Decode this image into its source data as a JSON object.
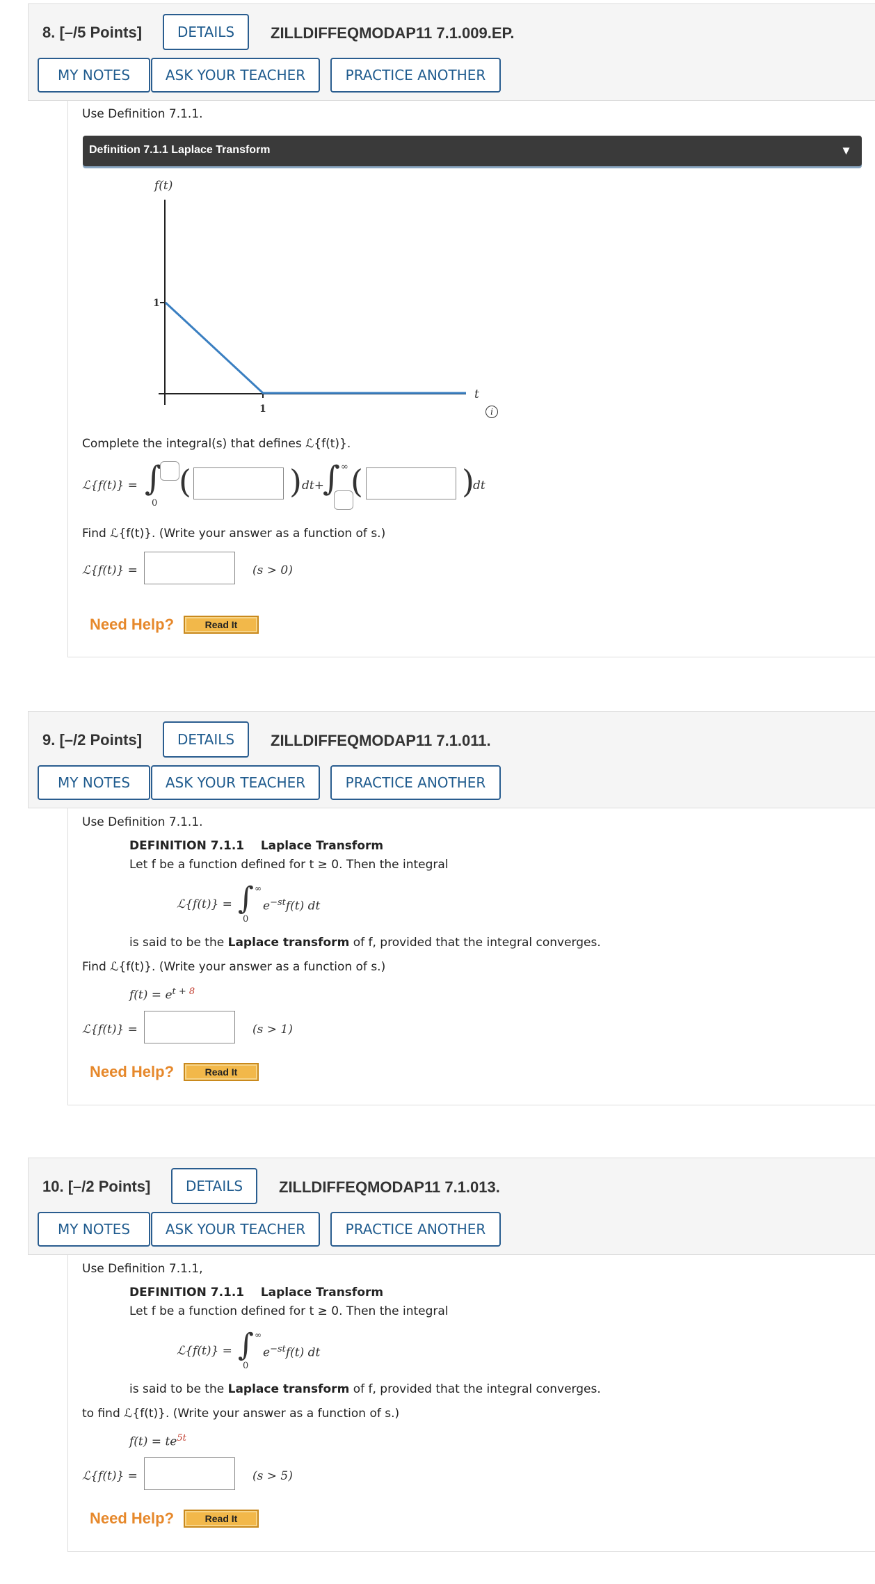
{
  "common": {
    "details": "DETAILS",
    "my_notes": "MY NOTES",
    "ask_teacher": "ASK YOUR TEACHER",
    "practice": "PRACTICE ANOTHER",
    "need_help": "Need Help?",
    "read_it": "Read It",
    "use_def": "Use Definition 7.1.1.",
    "lhs": "ℒ{f(t)} =",
    "def_title": "DEFINITION 7.1.1",
    "def_name": "Laplace Transform",
    "def_line1": "Let f be a function defined for t ≥ 0. Then the integral",
    "def_said_pre": "is said to be the ",
    "def_said_bold": "Laplace transform",
    "def_said_post": " of f, provided that the integral converges.",
    "integral_body": "e",
    "integral_exp": "−st",
    "integral_tail": "f(t) dt",
    "sup_inf": "∞",
    "sub_zero": "0"
  },
  "q8": {
    "number": "8.",
    "points": "[–/5 Points]",
    "code": "ZILLDIFFEQMODAP11 7.1.009.EP.",
    "def_bar": "Definition 7.1.1 Laplace Transform",
    "def_arrow": "▼",
    "graph": {
      "ylabel": "f(t)",
      "xlabel": "t",
      "ytick": "1",
      "xtick": "1",
      "line_color": "#3a7fc1"
    },
    "complete": "Complete the integral(s) that defines ℒ{f(t)}.",
    "dt_plus": "dt+",
    "dt": "dt",
    "find": "Find ℒ{f(t)}. (Write your answer as a function of s.)",
    "condition": "(s > 0)",
    "info_icon": "i"
  },
  "q9": {
    "number": "9.",
    "points": "[–/2 Points]",
    "code": "ZILLDIFFEQMODAP11 7.1.011.",
    "find": "Find ℒ{f(t)}. (Write your answer as a function of s.)",
    "f_lhs": "f(t) = e",
    "f_exp_a": "t + ",
    "f_exp_b": "8",
    "condition": "(s > 1)"
  },
  "q10": {
    "number": "10.",
    "points": "[–/2 Points]",
    "code": "ZILLDIFFEQMODAP11 7.1.013.",
    "use_def": "Use Definition 7.1.1,",
    "find": "to find ℒ{f(t)}. (Write your answer as a function of s.)",
    "f_lhs": "f(t) = te",
    "f_exp": "5t",
    "condition": "(s > 5)"
  }
}
